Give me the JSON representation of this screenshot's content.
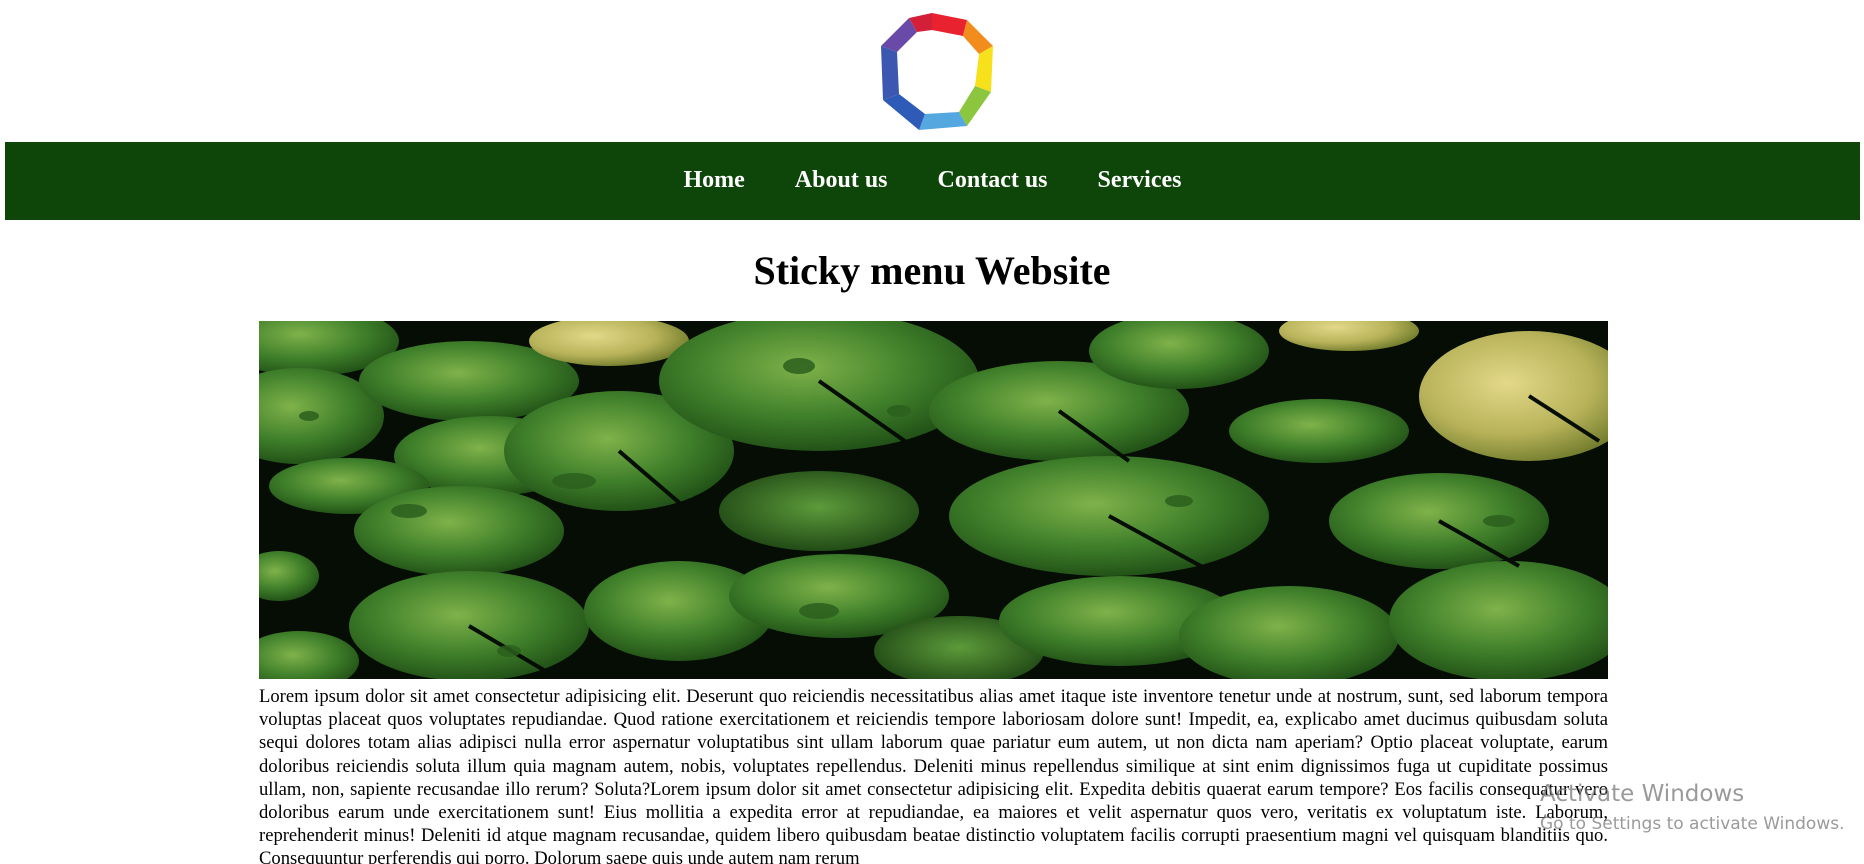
{
  "logo": {
    "icon": "heptagon-rainbow-logo-icon"
  },
  "nav": {
    "items": [
      {
        "label": "Home"
      },
      {
        "label": "About us"
      },
      {
        "label": "Contact us"
      },
      {
        "label": "Services"
      }
    ],
    "background": "#0e4509"
  },
  "main": {
    "title": "Sticky menu Website",
    "hero_image": "lily-pads-photo",
    "paragraph": "Lorem ipsum dolor sit amet consectetur adipisicing elit. Deserunt quo reiciendis necessitatibus alias amet itaque iste inventore tenetur unde at nostrum, sunt, sed laborum tempora voluptas placeat quos voluptates repudiandae. Quod ratione exercitationem et reiciendis tempore laboriosam dolore sunt! Impedit, ea, explicabo amet ducimus quibusdam soluta sequi dolores totam alias adipisci nulla error aspernatur voluptatibus sint ullam laborum quae pariatur eum autem, ut non dicta nam aperiam? Optio placeat voluptate, earum doloribus reiciendis soluta illum quia magnam autem, nobis, voluptates repellendus. Deleniti minus repellendus similique at sint enim dignissimos fuga ut cupiditate possimus ullam, non, sapiente recusandae illo rerum? Soluta?Lorem ipsum dolor sit amet consectetur adipisicing elit. Expedita debitis quaerat earum tempore? Eos facilis consequatur vero doloribus earum unde exercitationem sunt! Eius mollitia a expedita error at repudiandae, ea maiores et velit aspernatur quos vero, veritatis ex voluptatum iste. Laborum, reprehenderit minus! Deleniti id atque magnam recusandae, quidem libero quibusdam beatae distinctio voluptatem facilis corrupti praesentium magni vel quisquam blanditiis quo. Consequuntur perferendis qui porro. Dolorum saepe quis unde autem nam rerum"
  },
  "watermark": {
    "title": "Activate Windows",
    "subtitle": "Go to Settings to activate Windows."
  }
}
